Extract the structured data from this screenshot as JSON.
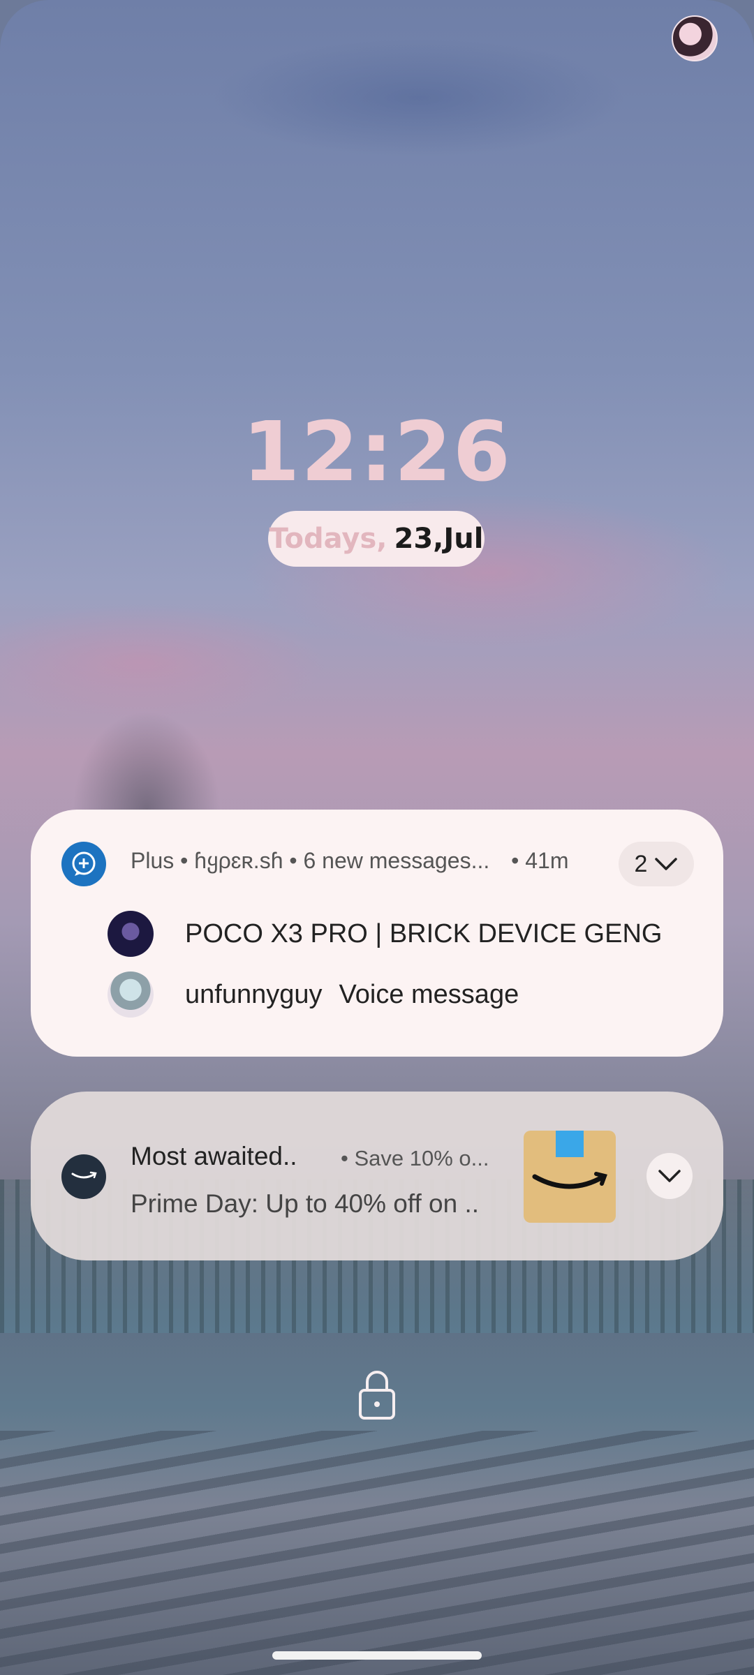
{
  "lockscreen": {
    "time": "12:26",
    "date_prefix": "Todays,",
    "date_value": "23,Jul"
  },
  "notifications": {
    "telegram": {
      "header": "Plus • ɦყρɛʀ.sɦ • 6 new messages...",
      "time": "• 41m",
      "count": "2",
      "messages": [
        {
          "text": "POCO X3 PRO | BRICK DEVICE GENG"
        },
        {
          "sender": "unfunnyguy",
          "text": "Voice message"
        }
      ]
    },
    "amazon": {
      "title": "Most awaited..",
      "meta": "• Save 10% o...",
      "body": "Prime Day: Up to 40% off on .."
    }
  },
  "colors": {
    "clock": "#efcdd3",
    "telegram_blue": "#1d73c0",
    "amazon_dark": "#232f3e"
  },
  "icons": {
    "app": "telegram-plus-icon",
    "expand": "chevron-down-icon",
    "lock": "lock-icon"
  }
}
